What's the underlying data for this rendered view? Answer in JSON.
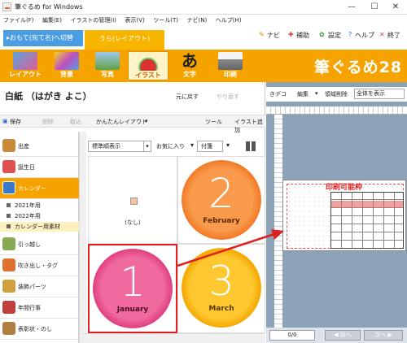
{
  "window": {
    "title": "筆ぐるめ for Windows",
    "minimize": "—",
    "maximize": "☐",
    "close": "✕"
  },
  "menu": [
    "ファイル(F)",
    "編集(E)",
    "イラストの管理(I)",
    "表示(V)",
    "ツール(T)",
    "ナビ(N)",
    "ヘルプ(H)"
  ],
  "tabs": {
    "front": "▸おもて(宛て名)へ切替",
    "back": "うら(レイアウト)"
  },
  "top_tools": {
    "navi": "ナビ",
    "assist": "補助",
    "settings": "設定",
    "help": "ヘルプ",
    "exit": "終了"
  },
  "ribbon": {
    "buttons": [
      "レイアウト",
      "背景",
      "写真",
      "イラスト",
      "文字",
      "印刷"
    ],
    "active": "イラスト",
    "brand": "筆ぐるめ28"
  },
  "panel": {
    "title": "白紙 （はがき よこ）",
    "undo": "元に戻す",
    "redo": "やり直す",
    "save": "保存",
    "delete": "削除",
    "cancel": "取込",
    "easy_layout": "かんたんレイアウト",
    "tools": "ツール",
    "add_illust": "イラスト追加"
  },
  "categories": [
    {
      "label": "出産",
      "color": "#c98a3a"
    },
    {
      "label": "誕生日",
      "color": "#e05050"
    },
    {
      "label": "カレンダー",
      "color": "#3a78c8",
      "active": true
    }
  ],
  "subcategories": [
    {
      "label": "2021年用"
    },
    {
      "label": "2022年用"
    },
    {
      "label": "カレンダー用素材",
      "active": true
    }
  ],
  "categories2": [
    {
      "label": "引っ越し",
      "color": "#88aa55"
    },
    {
      "label": "吹き出し・タグ",
      "color": "#e07030"
    },
    {
      "label": "装飾パーツ",
      "color": "#d0a040"
    },
    {
      "label": "年間行事",
      "color": "#c04040"
    },
    {
      "label": "表彰状・のし",
      "color": "#b08040"
    }
  ],
  "filter": {
    "sort": "標準順表示",
    "favorite": "お気に入り",
    "tag": "付箋"
  },
  "grid": [
    {
      "label": "(なし)"
    },
    {
      "number": "2",
      "month": "February",
      "color": "#f58a3c"
    },
    {
      "number": "1",
      "month": "January",
      "color": "#e8407c"
    },
    {
      "number": "3",
      "month": "March",
      "color": "#f5b800"
    }
  ],
  "right": {
    "deco": "きデコ",
    "edit": "編集",
    "erase": "領域削除",
    "view": "全体を表示",
    "print_area": "印刷可能枠",
    "page": "0/0",
    "prev": "◀ 前へ",
    "next": "次へ ▶"
  },
  "arrow_color": "#e02020"
}
